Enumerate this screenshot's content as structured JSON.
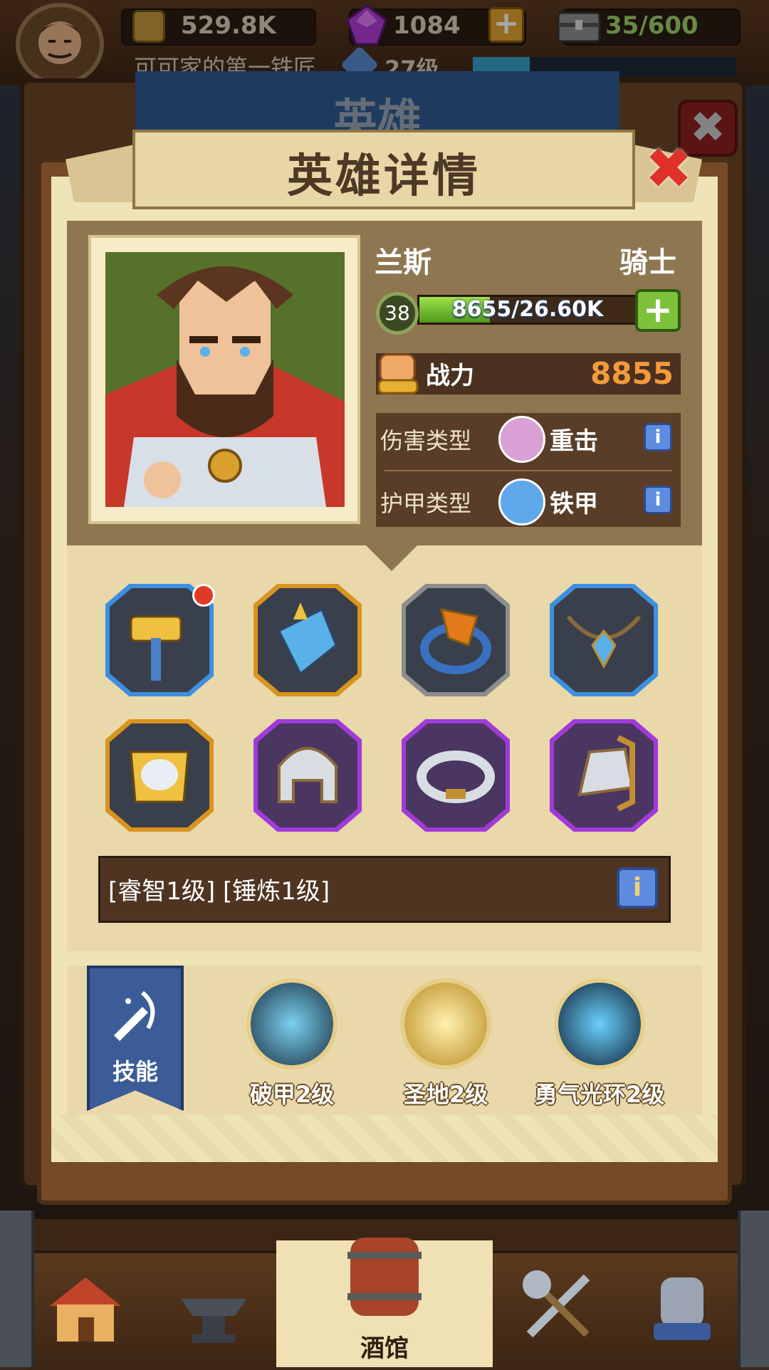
{
  "topbar": {
    "gold": "529.8K",
    "gems": "1084",
    "gem_add": "+",
    "storage": "35/600",
    "player_title": "可可家的第一铁匠",
    "player_level": "27级"
  },
  "back_panel": {
    "title": "英雄"
  },
  "dialog": {
    "title": "英雄详情",
    "close": "✖"
  },
  "hero": {
    "name": "兰斯",
    "class": "骑士",
    "level": "38",
    "xp_text": "8655/26.60K",
    "xp_fraction": 0.325,
    "power_label": "战力",
    "power_value": "8855",
    "damage_type_label": "伤害类型",
    "damage_type_value": "重击",
    "armor_type_label": "护甲类型",
    "armor_type_value": "铁甲",
    "info_icon": "i"
  },
  "equipment": {
    "slots": [
      {
        "icon": "hammer-icon",
        "rarity": "blue"
      },
      {
        "icon": "gauntlet-icon",
        "rarity": "gold"
      },
      {
        "icon": "ring-icon",
        "rarity": "gray"
      },
      {
        "icon": "amulet-icon",
        "rarity": "blue"
      },
      {
        "icon": "breastplate-icon",
        "rarity": "gold"
      },
      {
        "icon": "helmet-icon",
        "rarity": "purple"
      },
      {
        "icon": "bracelet-icon",
        "rarity": "purple"
      },
      {
        "icon": "pauldron-icon",
        "rarity": "purple"
      }
    ],
    "bonus_text": "[睿智1级] [锤炼1级]"
  },
  "skills": {
    "banner_label": "技能",
    "items": [
      {
        "name": "破甲2级"
      },
      {
        "name": "圣地2级"
      },
      {
        "name": "勇气光环2级"
      }
    ]
  },
  "nav": {
    "tavern_label": "酒馆"
  },
  "colors": {
    "rarity_blue": "#3d8fe0",
    "rarity_gold": "#d9941e",
    "rarity_gray": "#8d8d8d",
    "rarity_purple": "#a03ad8",
    "power_orange": "#f39a3a"
  }
}
